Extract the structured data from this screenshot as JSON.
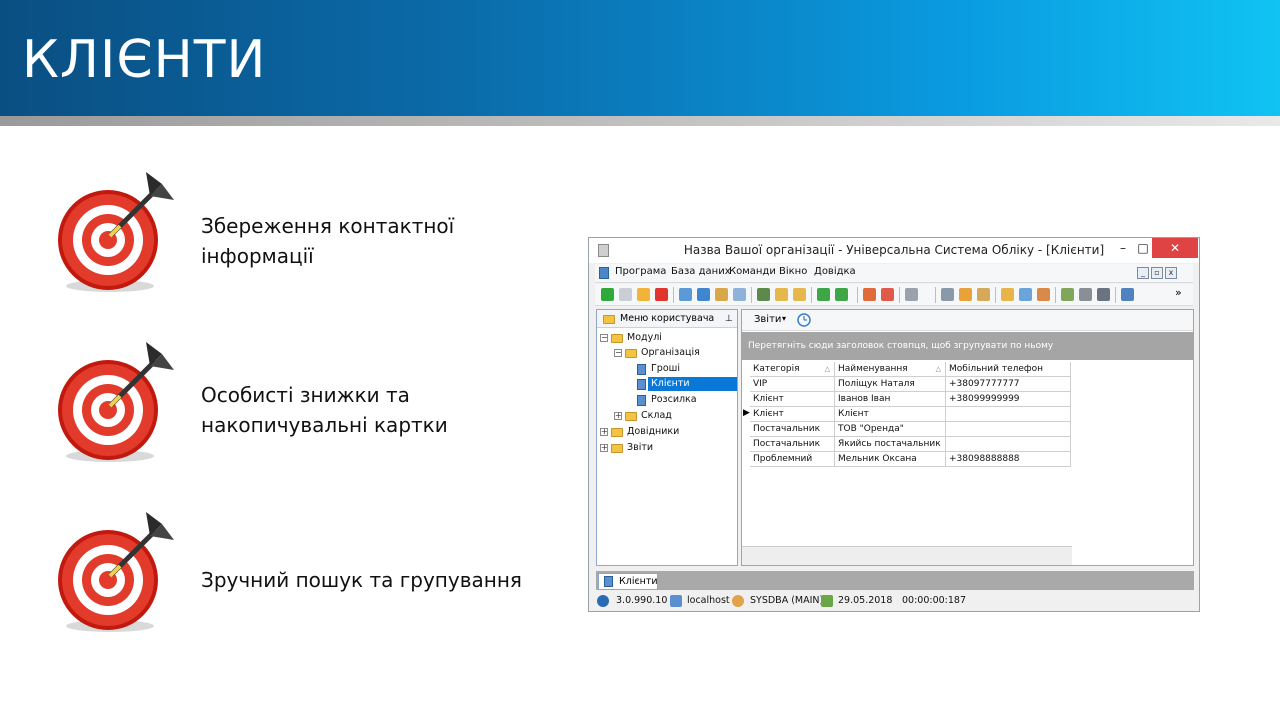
{
  "slide": {
    "title": "КЛІЄНТИ",
    "bullets": [
      {
        "line1": "Збереження контактної",
        "line2": "інформації"
      },
      {
        "line1": "Особисті знижки та",
        "line2": "накопичувальні картки"
      },
      {
        "line1": "Зручний пошук та групування",
        "line2": ""
      }
    ]
  },
  "window": {
    "title": "Назва Вашої організації - Універсальна Система Обліку - [Клієнти]",
    "controls": {
      "minimize": "–",
      "maximize": "□",
      "close": "✕"
    },
    "menu": [
      "Програма",
      "База даних",
      "Команди",
      "Вікно",
      "Довідка"
    ],
    "mdi_buttons": [
      "_",
      "▫",
      "x"
    ],
    "toolbar_overflow": "»",
    "left_panel": {
      "title": "Меню користувача",
      "pin": "⊥",
      "tree": {
        "modules": "Модулі",
        "organization": "Організація",
        "money": "Гроші",
        "clients": "Клієнти",
        "mailing": "Розсилка",
        "warehouse": "Склад",
        "directories": "Довідники",
        "reports": "Звіти"
      }
    },
    "right_panel": {
      "reports_button": "Звіти",
      "group_hint": "Перетягніть сюди заголовок стовпця, щоб згрупувати по ньому",
      "columns": [
        "Категорія",
        "Найменування",
        "Мобільний телефон"
      ],
      "rows": [
        [
          "VIP",
          "Поліщук Наталя",
          "+38097777777"
        ],
        [
          "Клієнт",
          "Іванов Іван",
          "+38099999999"
        ],
        [
          "Клієнт",
          "Клієнт",
          ""
        ],
        [
          "Постачальник",
          "ТОВ \"Оренда\"",
          ""
        ],
        [
          "Постачальник",
          "Якийсь постачальник",
          ""
        ],
        [
          "Проблемний",
          "Мельник Оксана",
          "+38098888888"
        ]
      ],
      "current_row": 2
    },
    "tab": "Клієнти",
    "status": {
      "version": "3.0.990.10",
      "host": "localhost",
      "user": "SYSDBA (MAIN)",
      "date": "29.05.2018",
      "time": "00:00:00:187"
    },
    "colors": {
      "header_dark": "#0a4f82",
      "header_light": "#10c3f3",
      "close": "#e04343",
      "selection": "#0a78d7",
      "target_red": "#d9271c"
    }
  }
}
